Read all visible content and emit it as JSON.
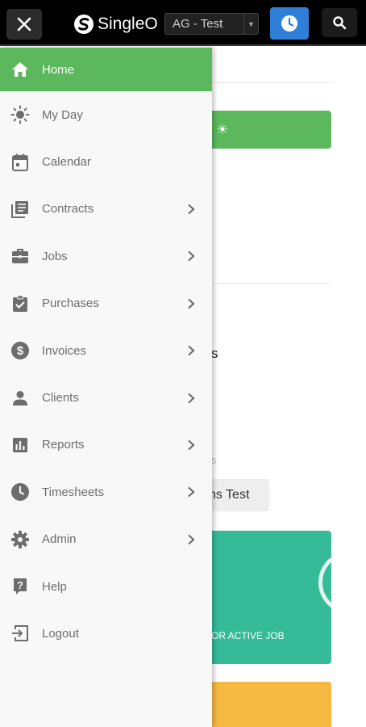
{
  "header": {
    "brand": "SingleO",
    "company_select": "AG - Test",
    "close_icon": "close-icon",
    "clock_icon": "clock-icon",
    "search_icon": "search-icon"
  },
  "background": {
    "greeting_suffix": "y ☀",
    "section_heading_fragment": "s",
    "small_label_fragment": "s",
    "company_chip": "ns Test",
    "active_job_label": "OR ACTIVE JOB"
  },
  "menu": {
    "items": [
      {
        "label": "Home",
        "icon": "home-icon",
        "has_submenu": false,
        "active": true
      },
      {
        "label": "My Day",
        "icon": "sun-icon",
        "has_submenu": false
      },
      {
        "label": "Calendar",
        "icon": "calendar-icon",
        "has_submenu": false
      },
      {
        "label": "Contracts",
        "icon": "contracts-icon",
        "has_submenu": true
      },
      {
        "label": "Jobs",
        "icon": "briefcase-icon",
        "has_submenu": true
      },
      {
        "label": "Purchases",
        "icon": "clipboard-check-icon",
        "has_submenu": true
      },
      {
        "label": "Invoices",
        "icon": "dollar-icon",
        "has_submenu": true
      },
      {
        "label": "Clients",
        "icon": "person-icon",
        "has_submenu": true
      },
      {
        "label": "Reports",
        "icon": "bar-chart-icon",
        "has_submenu": true
      },
      {
        "label": "Timesheets",
        "icon": "clock-icon",
        "has_submenu": true
      },
      {
        "label": "Admin",
        "icon": "gear-icon",
        "has_submenu": true
      },
      {
        "label": "Help",
        "icon": "help-icon",
        "has_submenu": false
      },
      {
        "label": "Logout",
        "icon": "logout-icon",
        "has_submenu": false
      }
    ]
  },
  "colors": {
    "active_green": "#5cb85c",
    "clock_blue": "#2f7ed8",
    "teal_card": "#35bb97",
    "yellow_card": "#f5b942"
  }
}
